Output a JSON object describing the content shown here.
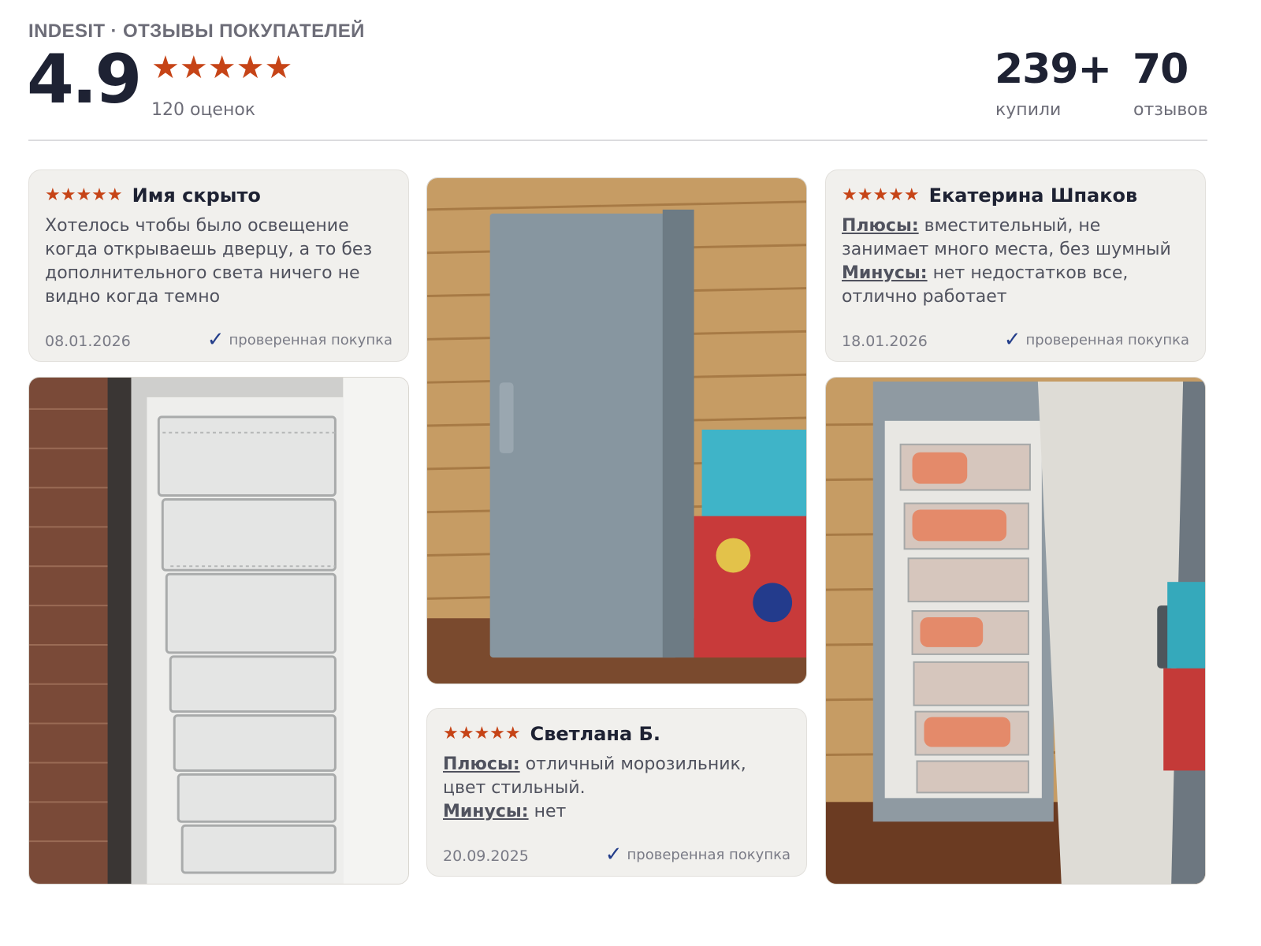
{
  "header": {
    "brand": "INDESIT · ОТЗЫВЫ ПОКУПАТЕЛЕЙ",
    "rating": "4.9",
    "stars": "★★★★★",
    "ratings_count": "120 оценок",
    "stats": [
      {
        "value": "239+",
        "label": "купили"
      },
      {
        "value": "70",
        "label": "отзывов"
      }
    ]
  },
  "reviews": [
    {
      "stars": "★★★★★",
      "author": "Имя скрыто",
      "text": "Хотелось чтобы было освещение когда открываешь дверцу, а то без дополнительного света ничего не видно когда темно",
      "date": "08.01.2026",
      "verified": "проверенная покупка"
    },
    {
      "stars": "★★★★★",
      "author": "Светлана Б.",
      "pros_label": "Плюсы:",
      "pros": " отличный морозильник, цвет стильный.",
      "cons_label": "Минусы:",
      "cons": " нет",
      "date": "20.09.2025",
      "verified": "проверенная покупка"
    },
    {
      "stars": "★★★★★",
      "author": "Екатерина Шпаков",
      "pros_label": "Плюсы:",
      "pros": " вместительный, не занимает много места, без шумный",
      "cons_label": "Минусы:",
      "cons": " нет недостатков все, отлично работает",
      "date": "18.01.2026",
      "verified": "проверенная покупка"
    }
  ],
  "icons": {
    "verified": "checkmark-icon",
    "rating": "star-icon"
  },
  "colors": {
    "star": "#c64417",
    "check": "#233d8a",
    "card_bg": "#f1f0ed"
  }
}
